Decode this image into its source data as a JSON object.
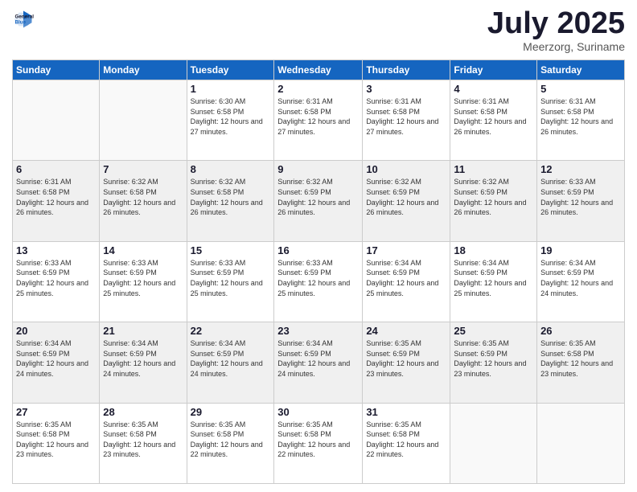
{
  "header": {
    "logo_line1": "General",
    "logo_line2": "Blue",
    "month": "July 2025",
    "location": "Meerzorg, Suriname"
  },
  "days_of_week": [
    "Sunday",
    "Monday",
    "Tuesday",
    "Wednesday",
    "Thursday",
    "Friday",
    "Saturday"
  ],
  "weeks": [
    {
      "days": [
        {
          "num": "",
          "sunrise": "",
          "sunset": "",
          "daylight": "",
          "empty": true
        },
        {
          "num": "",
          "sunrise": "",
          "sunset": "",
          "daylight": "",
          "empty": true
        },
        {
          "num": "1",
          "sunrise": "Sunrise: 6:30 AM",
          "sunset": "Sunset: 6:58 PM",
          "daylight": "Daylight: 12 hours and 27 minutes.",
          "empty": false
        },
        {
          "num": "2",
          "sunrise": "Sunrise: 6:31 AM",
          "sunset": "Sunset: 6:58 PM",
          "daylight": "Daylight: 12 hours and 27 minutes.",
          "empty": false
        },
        {
          "num": "3",
          "sunrise": "Sunrise: 6:31 AM",
          "sunset": "Sunset: 6:58 PM",
          "daylight": "Daylight: 12 hours and 27 minutes.",
          "empty": false
        },
        {
          "num": "4",
          "sunrise": "Sunrise: 6:31 AM",
          "sunset": "Sunset: 6:58 PM",
          "daylight": "Daylight: 12 hours and 26 minutes.",
          "empty": false
        },
        {
          "num": "5",
          "sunrise": "Sunrise: 6:31 AM",
          "sunset": "Sunset: 6:58 PM",
          "daylight": "Daylight: 12 hours and 26 minutes.",
          "empty": false
        }
      ]
    },
    {
      "days": [
        {
          "num": "6",
          "sunrise": "Sunrise: 6:31 AM",
          "sunset": "Sunset: 6:58 PM",
          "daylight": "Daylight: 12 hours and 26 minutes.",
          "empty": false
        },
        {
          "num": "7",
          "sunrise": "Sunrise: 6:32 AM",
          "sunset": "Sunset: 6:58 PM",
          "daylight": "Daylight: 12 hours and 26 minutes.",
          "empty": false
        },
        {
          "num": "8",
          "sunrise": "Sunrise: 6:32 AM",
          "sunset": "Sunset: 6:58 PM",
          "daylight": "Daylight: 12 hours and 26 minutes.",
          "empty": false
        },
        {
          "num": "9",
          "sunrise": "Sunrise: 6:32 AM",
          "sunset": "Sunset: 6:59 PM",
          "daylight": "Daylight: 12 hours and 26 minutes.",
          "empty": false
        },
        {
          "num": "10",
          "sunrise": "Sunrise: 6:32 AM",
          "sunset": "Sunset: 6:59 PM",
          "daylight": "Daylight: 12 hours and 26 minutes.",
          "empty": false
        },
        {
          "num": "11",
          "sunrise": "Sunrise: 6:32 AM",
          "sunset": "Sunset: 6:59 PM",
          "daylight": "Daylight: 12 hours and 26 minutes.",
          "empty": false
        },
        {
          "num": "12",
          "sunrise": "Sunrise: 6:33 AM",
          "sunset": "Sunset: 6:59 PM",
          "daylight": "Daylight: 12 hours and 26 minutes.",
          "empty": false
        }
      ]
    },
    {
      "days": [
        {
          "num": "13",
          "sunrise": "Sunrise: 6:33 AM",
          "sunset": "Sunset: 6:59 PM",
          "daylight": "Daylight: 12 hours and 25 minutes.",
          "empty": false
        },
        {
          "num": "14",
          "sunrise": "Sunrise: 6:33 AM",
          "sunset": "Sunset: 6:59 PM",
          "daylight": "Daylight: 12 hours and 25 minutes.",
          "empty": false
        },
        {
          "num": "15",
          "sunrise": "Sunrise: 6:33 AM",
          "sunset": "Sunset: 6:59 PM",
          "daylight": "Daylight: 12 hours and 25 minutes.",
          "empty": false
        },
        {
          "num": "16",
          "sunrise": "Sunrise: 6:33 AM",
          "sunset": "Sunset: 6:59 PM",
          "daylight": "Daylight: 12 hours and 25 minutes.",
          "empty": false
        },
        {
          "num": "17",
          "sunrise": "Sunrise: 6:34 AM",
          "sunset": "Sunset: 6:59 PM",
          "daylight": "Daylight: 12 hours and 25 minutes.",
          "empty": false
        },
        {
          "num": "18",
          "sunrise": "Sunrise: 6:34 AM",
          "sunset": "Sunset: 6:59 PM",
          "daylight": "Daylight: 12 hours and 25 minutes.",
          "empty": false
        },
        {
          "num": "19",
          "sunrise": "Sunrise: 6:34 AM",
          "sunset": "Sunset: 6:59 PM",
          "daylight": "Daylight: 12 hours and 24 minutes.",
          "empty": false
        }
      ]
    },
    {
      "days": [
        {
          "num": "20",
          "sunrise": "Sunrise: 6:34 AM",
          "sunset": "Sunset: 6:59 PM",
          "daylight": "Daylight: 12 hours and 24 minutes.",
          "empty": false
        },
        {
          "num": "21",
          "sunrise": "Sunrise: 6:34 AM",
          "sunset": "Sunset: 6:59 PM",
          "daylight": "Daylight: 12 hours and 24 minutes.",
          "empty": false
        },
        {
          "num": "22",
          "sunrise": "Sunrise: 6:34 AM",
          "sunset": "Sunset: 6:59 PM",
          "daylight": "Daylight: 12 hours and 24 minutes.",
          "empty": false
        },
        {
          "num": "23",
          "sunrise": "Sunrise: 6:34 AM",
          "sunset": "Sunset: 6:59 PM",
          "daylight": "Daylight: 12 hours and 24 minutes.",
          "empty": false
        },
        {
          "num": "24",
          "sunrise": "Sunrise: 6:35 AM",
          "sunset": "Sunset: 6:59 PM",
          "daylight": "Daylight: 12 hours and 23 minutes.",
          "empty": false
        },
        {
          "num": "25",
          "sunrise": "Sunrise: 6:35 AM",
          "sunset": "Sunset: 6:59 PM",
          "daylight": "Daylight: 12 hours and 23 minutes.",
          "empty": false
        },
        {
          "num": "26",
          "sunrise": "Sunrise: 6:35 AM",
          "sunset": "Sunset: 6:58 PM",
          "daylight": "Daylight: 12 hours and 23 minutes.",
          "empty": false
        }
      ]
    },
    {
      "days": [
        {
          "num": "27",
          "sunrise": "Sunrise: 6:35 AM",
          "sunset": "Sunset: 6:58 PM",
          "daylight": "Daylight: 12 hours and 23 minutes.",
          "empty": false
        },
        {
          "num": "28",
          "sunrise": "Sunrise: 6:35 AM",
          "sunset": "Sunset: 6:58 PM",
          "daylight": "Daylight: 12 hours and 23 minutes.",
          "empty": false
        },
        {
          "num": "29",
          "sunrise": "Sunrise: 6:35 AM",
          "sunset": "Sunset: 6:58 PM",
          "daylight": "Daylight: 12 hours and 22 minutes.",
          "empty": false
        },
        {
          "num": "30",
          "sunrise": "Sunrise: 6:35 AM",
          "sunset": "Sunset: 6:58 PM",
          "daylight": "Daylight: 12 hours and 22 minutes.",
          "empty": false
        },
        {
          "num": "31",
          "sunrise": "Sunrise: 6:35 AM",
          "sunset": "Sunset: 6:58 PM",
          "daylight": "Daylight: 12 hours and 22 minutes.",
          "empty": false
        },
        {
          "num": "",
          "sunrise": "",
          "sunset": "",
          "daylight": "",
          "empty": true
        },
        {
          "num": "",
          "sunrise": "",
          "sunset": "",
          "daylight": "",
          "empty": true
        }
      ]
    }
  ]
}
